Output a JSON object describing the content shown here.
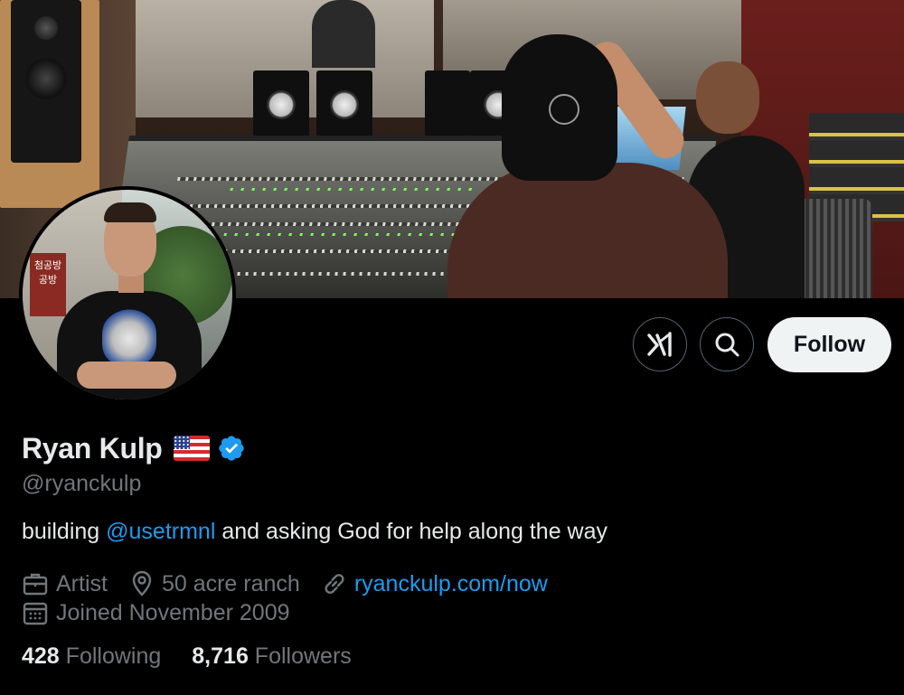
{
  "profile": {
    "name": "Ryan Kulp",
    "flag_emoji": "us-flag",
    "handle": "@ryanckulp",
    "bio_prefix": "building ",
    "bio_mention": "@usetrmnl",
    "bio_suffix": " and asking God for help along the way",
    "profession": "Artist",
    "location": "50 acre ranch",
    "website": "ryanckulp.com/now",
    "joined": "Joined November 2009",
    "following_count": "428",
    "following_label": "Following",
    "followers_count": "8,716",
    "followers_label": "Followers"
  },
  "actions": {
    "grok_icon": "grok-icon",
    "search_icon": "search-icon",
    "follow_label": "Follow"
  },
  "colors": {
    "background": "#000000",
    "text_primary": "#e7e9ea",
    "text_secondary": "#71767b",
    "link": "#1d9bf0",
    "verified": "#1d9bf0",
    "follow_bg": "#eff3f4"
  }
}
